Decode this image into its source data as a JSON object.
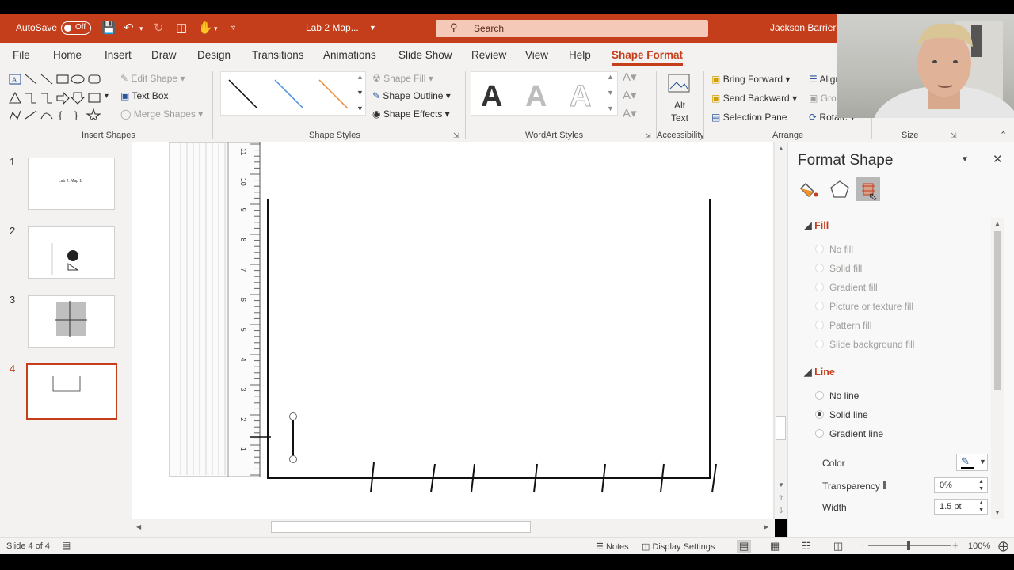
{
  "titlebar": {
    "autosave_label": "AutoSave",
    "autosave_state": "Off",
    "doc_title": "Lab 2 Map...",
    "search_placeholder": "Search",
    "user_name": "Jackson Barrier",
    "bg_color": "#c43e1c"
  },
  "tabs": [
    "File",
    "Home",
    "Insert",
    "Draw",
    "Design",
    "Transitions",
    "Animations",
    "Slide Show",
    "Review",
    "View",
    "Help",
    "Shape Format"
  ],
  "active_tab": "Shape Format",
  "ribbon": {
    "insert_shapes": {
      "edit_shape": "Edit Shape",
      "text_box": "Text Box",
      "merge_shapes": "Merge Shapes",
      "label": "Insert Shapes"
    },
    "shape_styles": {
      "fill": "Shape Fill",
      "outline": "Shape Outline",
      "effects": "Shape Effects",
      "label": "Shape Styles"
    },
    "wordart": {
      "label": "WordArt Styles",
      "sample": "A"
    },
    "accessibility": {
      "alt_text": "Alt Text",
      "alt_line1": "Alt",
      "alt_line2": "Text",
      "label": "Accessibility"
    },
    "arrange": {
      "bring_forward": "Bring Forward",
      "send_backward": "Send Backward",
      "selection_pane": "Selection Pane",
      "align": "Align",
      "group": "Group",
      "rotate": "Rotate",
      "label": "Arrange"
    },
    "size": {
      "label": "Size"
    }
  },
  "slides": [
    {
      "num": "1",
      "text": "Lab 2: Map 1"
    },
    {
      "num": "2",
      "text": ""
    },
    {
      "num": "3",
      "text": ""
    },
    {
      "num": "4",
      "text": ""
    }
  ],
  "ruler_labels": [
    "11",
    "10",
    "9",
    "8",
    "7",
    "6",
    "5",
    "4",
    "3",
    "2",
    "1"
  ],
  "format_pane": {
    "title": "Format Shape",
    "fill_section": "Fill",
    "fill_options": [
      "No fill",
      "Solid fill",
      "Gradient fill",
      "Picture or texture fill",
      "Pattern fill",
      "Slide background fill"
    ],
    "line_section": "Line",
    "line_options": [
      "No line",
      "Solid line",
      "Gradient line"
    ],
    "line_selected": "Solid line",
    "color_label": "Color",
    "transparency_label": "Transparency",
    "transparency_value": "0%",
    "width_label": "Width",
    "width_value": "1.5 pt"
  },
  "status": {
    "slide_info": "Slide 4 of 4",
    "notes": "Notes",
    "display_settings": "Display Settings",
    "zoom": "100%"
  }
}
